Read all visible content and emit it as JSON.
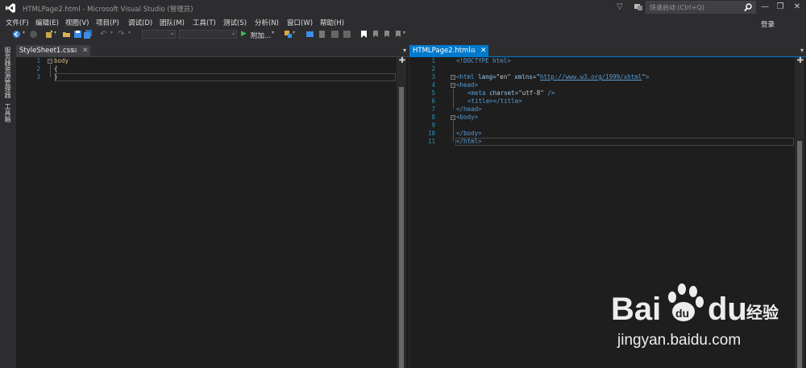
{
  "window": {
    "title": "HTMLPage2.html - Microsoft Visual Studio (管理员)",
    "quick_launch_placeholder": "快速启动 (Ctrl+Q)",
    "login": "登录"
  },
  "menu": [
    "文件(F)",
    "编辑(E)",
    "视图(V)",
    "项目(P)",
    "调试(D)",
    "团队(M)",
    "工具(T)",
    "测试(S)",
    "分析(N)",
    "窗口(W)",
    "帮助(H)"
  ],
  "toolbar": {
    "attach_label": "附加..."
  },
  "side_tabs": [
    "服务器资源管理器",
    "工具箱"
  ],
  "left_doc": {
    "tab": "StyleSheet1.css",
    "lines": [
      {
        "num": "1",
        "text": "body"
      },
      {
        "num": "2",
        "text": "{"
      },
      {
        "num": "3",
        "text": "}"
      }
    ]
  },
  "right_doc": {
    "tab": "HTMLPage2.html",
    "lines": [
      {
        "num": "1",
        "parts": [
          "<!DOCTYPE html>"
        ]
      },
      {
        "num": "2",
        "parts": []
      },
      {
        "num": "3",
        "parts": [
          "<html",
          " lang=",
          "\"en\"",
          " xmlns=",
          "\"",
          "http://www.w3.org/1999/xhtml",
          "\"",
          ">"
        ]
      },
      {
        "num": "4",
        "parts": [
          "<head>"
        ]
      },
      {
        "num": "5",
        "parts": [
          "<meta",
          " charset=",
          "\"utf-8\"",
          " />"
        ]
      },
      {
        "num": "6",
        "parts": [
          "<title></title>"
        ]
      },
      {
        "num": "7",
        "parts": [
          "</head>"
        ]
      },
      {
        "num": "8",
        "parts": [
          "<body>"
        ]
      },
      {
        "num": "9",
        "parts": []
      },
      {
        "num": "10",
        "parts": [
          "</body>"
        ]
      },
      {
        "num": "11",
        "parts": [
          "</html>"
        ]
      }
    ]
  },
  "watermark": {
    "url": "jingyan.baidu.com",
    "brand": "Bai du 经验"
  },
  "colors": {
    "accent": "#007acc",
    "editor_bg": "#1e1e1e",
    "chrome_bg": "#2d2d30",
    "line_number": "#2b91af"
  }
}
